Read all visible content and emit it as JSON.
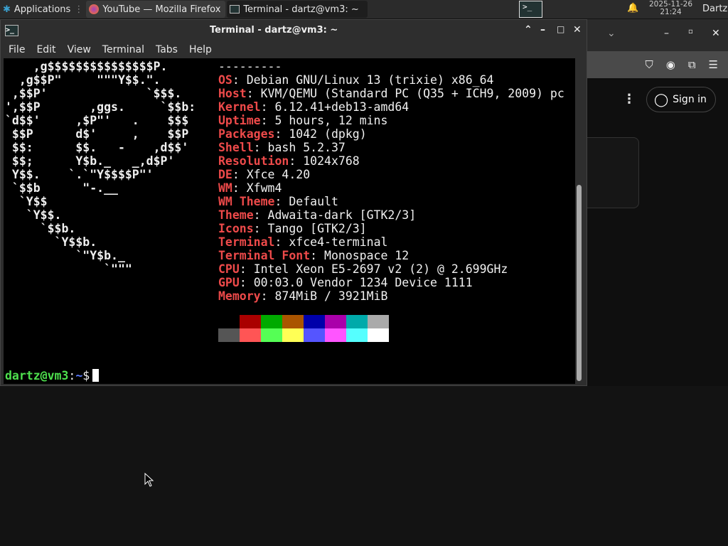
{
  "panel": {
    "applications": "Applications",
    "tasks": [
      {
        "label": "YouTube — Mozilla Firefox",
        "icon": "firefox-icon"
      },
      {
        "label": "Terminal - dartz@vm3: ~",
        "icon": "terminal-icon"
      }
    ],
    "date": "2025-11-26",
    "time": "21:24",
    "user": "Dartz"
  },
  "terminal": {
    "title": "Terminal - dartz@vm3: ~",
    "menu": [
      "File",
      "Edit",
      "View",
      "Terminal",
      "Tabs",
      "Help"
    ],
    "art": "    ,g$$$$$$$$$$$$$$$P.\n  ,g$$P\"     \"\"\"Y$$.\".\n ,$$P'              `$$$.\n',$$P       ,ggs.     `$$b:\n`d$$'     ,$P\"'   .    $$$\n $$P      d$'     ,    $$P\n $$:      $$.   -    ,d$$'\n $$;      Y$b._   _,d$P'\n Y$$.    `.`\"Y$$$$P\"'\n `$$b      \"-.__\n  `Y$$\n   `Y$$.\n     `$$b.\n       `Y$$b.\n          `\"Y$b._\n              `\"\"\"",
    "separator": "---------",
    "info": [
      [
        "OS",
        "Debian GNU/Linux 13 (trixie) x86_64"
      ],
      [
        "Host",
        "KVM/QEMU (Standard PC (Q35 + ICH9, 2009) pc"
      ],
      [
        "Kernel",
        "6.12.41+deb13-amd64"
      ],
      [
        "Uptime",
        "5 hours, 12 mins"
      ],
      [
        "Packages",
        "1042 (dpkg)"
      ],
      [
        "Shell",
        "bash 5.2.37"
      ],
      [
        "Resolution",
        "1024x768"
      ],
      [
        "DE",
        "Xfce 4.20"
      ],
      [
        "WM",
        "Xfwm4"
      ],
      [
        "WM Theme",
        "Default"
      ],
      [
        "Theme",
        "Adwaita-dark [GTK2/3]"
      ],
      [
        "Icons",
        "Tango [GTK2/3]"
      ],
      [
        "Terminal",
        "xfce4-terminal"
      ],
      [
        "Terminal Font",
        "Monospace 12"
      ],
      [
        "CPU",
        "Intel Xeon E5-2697 v2 (2) @ 2.699GHz"
      ],
      [
        "GPU",
        "00:03.0 Vendor 1234 Device 1111"
      ],
      [
        "Memory",
        "874MiB / 3921MiB"
      ]
    ],
    "palette": [
      "#000000",
      "#aa0000",
      "#00aa00",
      "#aa5500",
      "#0000aa",
      "#aa00aa",
      "#00aaaa",
      "#aaaaaa",
      "#555555",
      "#ff5555",
      "#55ff55",
      "#ffff55",
      "#5555ff",
      "#ff55ff",
      "#55ffff",
      "#ffffff"
    ],
    "prompt": {
      "user": "dartz@vm3",
      "sep": ":",
      "path": "~",
      "sym": "$"
    }
  },
  "firefox": {
    "sign_in": "Sign in"
  }
}
